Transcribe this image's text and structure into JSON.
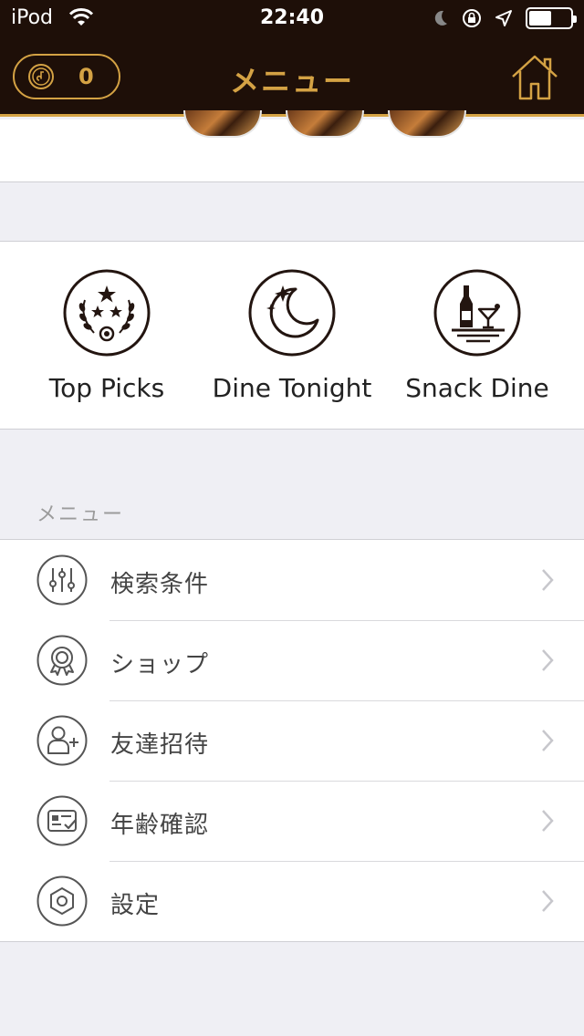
{
  "status_bar": {
    "carrier": "iPod",
    "time": "22:40"
  },
  "nav": {
    "points": "0",
    "title": "メニュー"
  },
  "categories": [
    {
      "label": "Top Picks",
      "icon": "top-picks-icon"
    },
    {
      "label": "Dine Tonight",
      "icon": "moon-stars-icon"
    },
    {
      "label": "Snack Dine",
      "icon": "bottle-cocktail-icon"
    }
  ],
  "menu_section": {
    "header": "メニュー",
    "items": [
      {
        "label": "検索条件",
        "icon": "sliders-icon"
      },
      {
        "label": "ショップ",
        "icon": "badge-icon"
      },
      {
        "label": "友達招待",
        "icon": "add-user-icon"
      },
      {
        "label": "年齢確認",
        "icon": "id-card-check-icon"
      },
      {
        "label": "設定",
        "icon": "hexagon-settings-icon"
      }
    ]
  },
  "colors": {
    "nav_bg": "#1e0f08",
    "accent_gold": "#d4a244",
    "background": "#efeff4"
  }
}
